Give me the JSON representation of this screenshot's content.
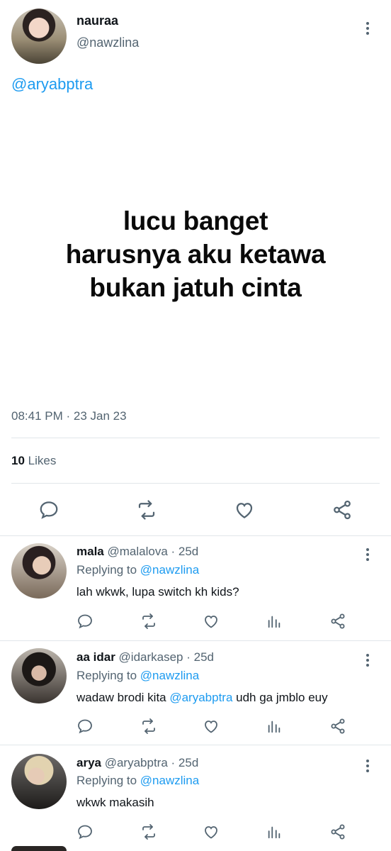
{
  "tweet": {
    "author_name": "nauraa",
    "author_handle": "@nawzlina",
    "mention": "@aryabptra",
    "text_lines": [
      "lucu banget",
      "harusnya aku ketawa",
      "bukan jatuh cinta"
    ],
    "timestamp": "08:41 PM · 23 Jan 23",
    "likes_count": "10",
    "likes_label": "Likes"
  },
  "icons": {
    "more": "more-vertical-icon",
    "reply": "reply-icon",
    "retweet": "retweet-icon",
    "like": "heart-icon",
    "share": "share-icon",
    "analytics": "analytics-icon"
  },
  "colors": {
    "link": "#1d9bf0",
    "secondary_text": "#536471",
    "icon": "#536471",
    "divider": "#e1e6ea"
  },
  "replies": [
    {
      "name": "mala",
      "handle": "@malalova",
      "age": "· 25d",
      "replying_prefix": "Replying to",
      "replying_to": "@nawzlina",
      "text": "lah wkwk, lupa switch kh kids?"
    },
    {
      "name": "aa idar",
      "handle": "@idarkasep",
      "age": "· 25d",
      "replying_prefix": "Replying to",
      "replying_to": "@nawzlina",
      "text_before": "wadaw brodi kita ",
      "text_mention": "@aryabptra",
      "text_after": " udh ga jmblo euy"
    },
    {
      "name": "arya",
      "handle": "@aryabptra",
      "age": "· 25d",
      "replying_prefix": "Replying to",
      "replying_to": "@nawzlina",
      "text": "wkwk makasih"
    }
  ]
}
